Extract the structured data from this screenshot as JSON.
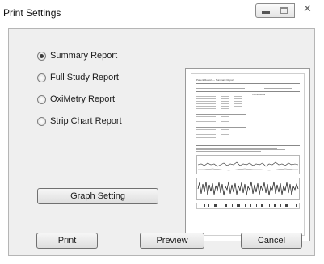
{
  "window": {
    "title": "Print Settings",
    "controls": {
      "minimize_icon": "minimize-icon",
      "maximize_icon": "maximize-icon",
      "close_glyph": "✕"
    }
  },
  "report_options": [
    {
      "label": "Summary Report",
      "checked": true
    },
    {
      "label": "Full Study Report",
      "checked": false
    },
    {
      "label": "OxiMetry Report",
      "checked": false
    },
    {
      "label": "Strip Chart Report",
      "checked": false
    }
  ],
  "buttons": {
    "graph_setting": "Graph Setting",
    "print": "Print",
    "preview": "Preview",
    "cancel": "Cancel"
  },
  "preview": {
    "header_left": "Patient Report — Summary Report",
    "summary_heading": "Impressions"
  },
  "colors": {
    "panel_bg": "#efefef",
    "border": "#b5b5b5",
    "button_border": "#707070"
  }
}
